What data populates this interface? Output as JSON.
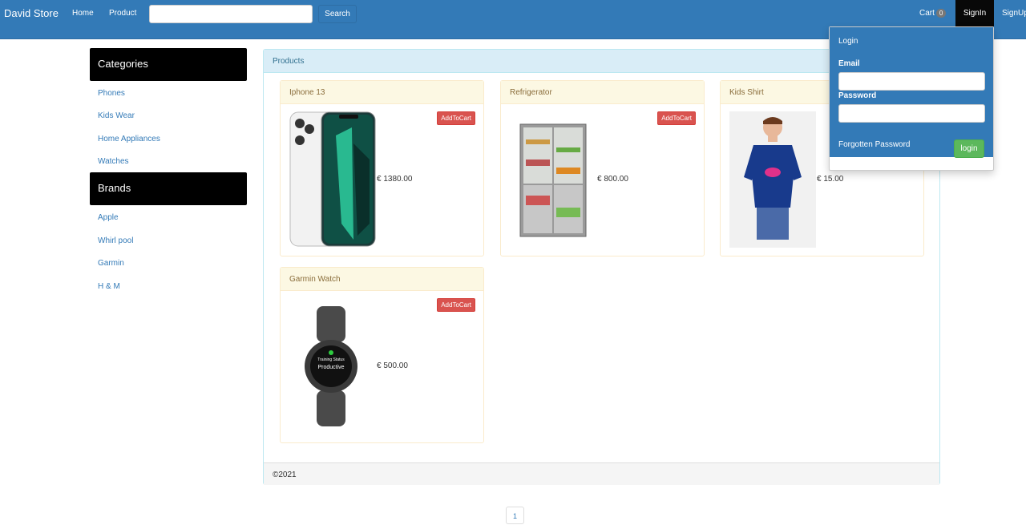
{
  "navbar": {
    "brand": "David Store",
    "home": "Home",
    "product": "Product",
    "search_button": "Search",
    "cart_label": "Cart",
    "cart_count": "0",
    "signin": "SignIn",
    "signup": "SignUp"
  },
  "sidebar": {
    "categories_title": "Categories",
    "categories": [
      "Phones",
      "Kids Wear",
      "Home Appliances",
      "Watches"
    ],
    "brands_title": "Brands",
    "brands": [
      "Apple",
      "Whirl pool",
      "Garmin",
      "H & M"
    ]
  },
  "products": {
    "title": "Products",
    "add_label": "AddToCart",
    "items": [
      {
        "name": "Iphone 13",
        "price": "€ 1380.00"
      },
      {
        "name": "Refrigerator",
        "price": "€ 800.00"
      },
      {
        "name": "Kids Shirt",
        "price": "€ 15.00"
      },
      {
        "name": "Garmin Watch",
        "price": "€ 500.00"
      }
    ],
    "footer": "©2021"
  },
  "login": {
    "title": "Login",
    "email_label": "Email",
    "password_label": "Password",
    "forgot": "Forgotten Password",
    "button": "login"
  },
  "pagination": {
    "page": "1"
  }
}
